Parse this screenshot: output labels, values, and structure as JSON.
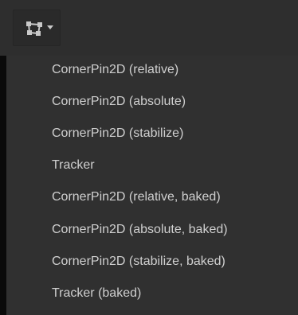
{
  "toolbar": {
    "tool_icon": "corner-pin-icon",
    "dropdown_icon": "caret-down-icon",
    "icon_color": "#c9c9c9"
  },
  "menu": {
    "items": [
      {
        "label": "CornerPin2D (relative)"
      },
      {
        "label": "CornerPin2D (absolute)"
      },
      {
        "label": "CornerPin2D (stabilize)"
      },
      {
        "label": "Tracker"
      },
      {
        "label": "CornerPin2D (relative, baked)"
      },
      {
        "label": "CornerPin2D (absolute, baked)"
      },
      {
        "label": "CornerPin2D (stabilize, baked)"
      },
      {
        "label": "Tracker (baked)"
      }
    ]
  },
  "colors": {
    "menu_background": "#303030",
    "menu_text": "#cfcfcf",
    "toolbar_background": "#2e2e2e"
  }
}
